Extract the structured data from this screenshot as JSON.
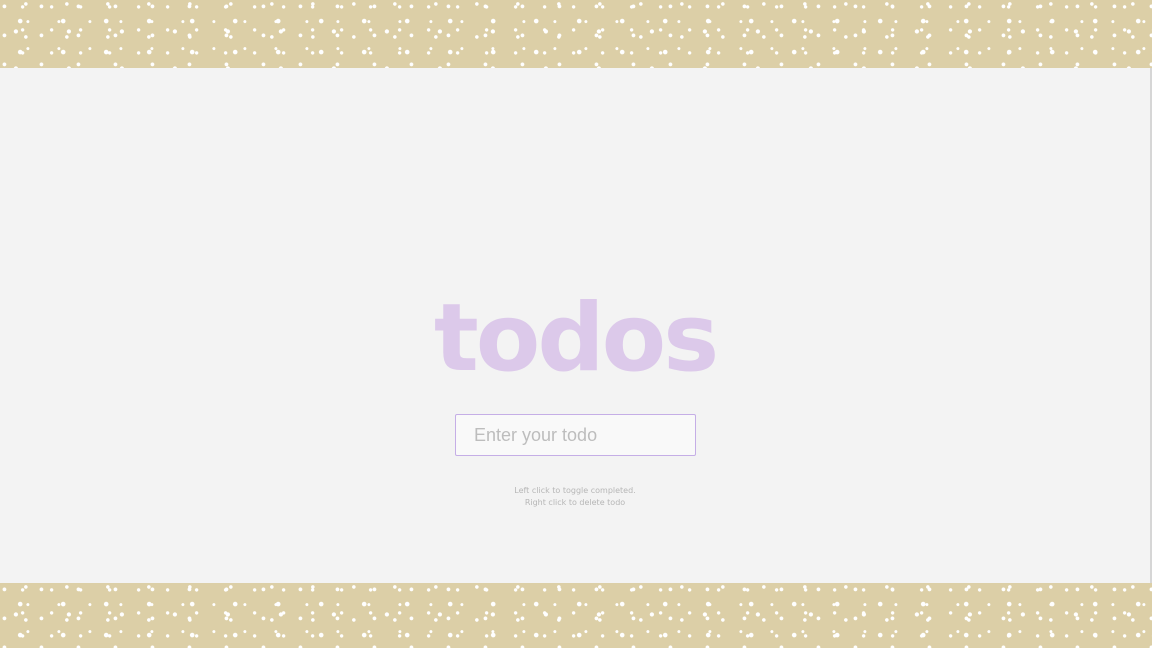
{
  "app": {
    "title": "todos"
  },
  "input": {
    "placeholder": "Enter your todo",
    "value": ""
  },
  "hints": {
    "line1": "Left click to toggle completed.",
    "line2": "Right click to delete todo"
  },
  "colors": {
    "background_band": "#dccfa7",
    "stage": "#f3f3f3",
    "title": "#dcc9ea",
    "input_border": "#c5aee6",
    "hint_text": "#b6b6b6"
  }
}
